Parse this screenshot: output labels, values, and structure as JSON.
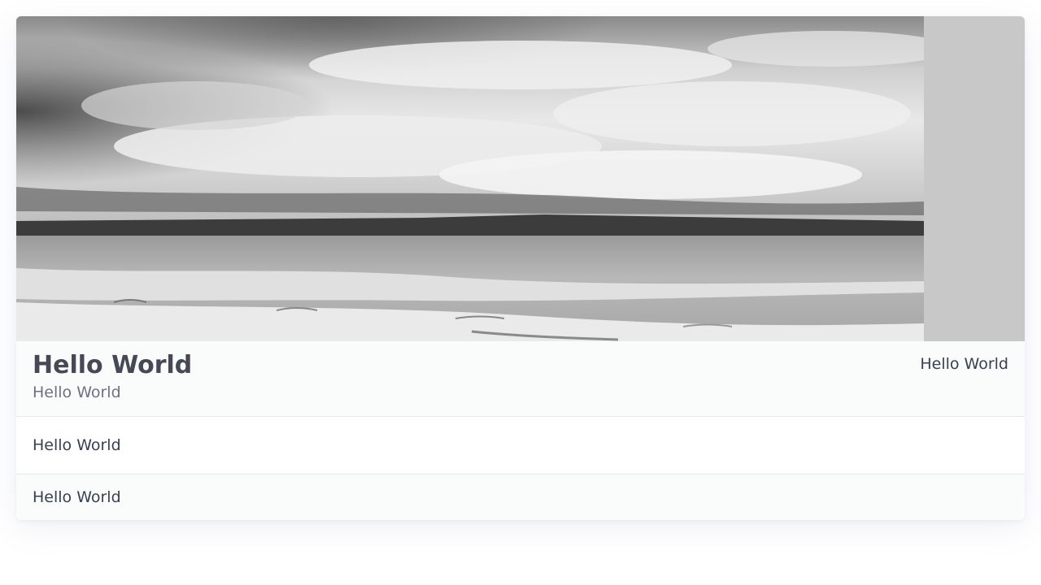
{
  "card": {
    "image": {
      "description_icon": "beach-seascape-photo"
    },
    "header": {
      "title": "Hello World",
      "subtitle": "Hello World",
      "aside": "Hello World"
    },
    "row": {
      "text": "Hello World"
    },
    "footer": {
      "text": "Hello World"
    }
  },
  "colors": {
    "card_bg": "#ffffff",
    "header_bg": "#fafbfb",
    "footer_bg": "#fafbfb",
    "placeholder_bg": "#c8c8c8",
    "title": "#454955",
    "subtitle": "#6b7280",
    "text": "#374151",
    "divider": "#e5e7eb"
  }
}
